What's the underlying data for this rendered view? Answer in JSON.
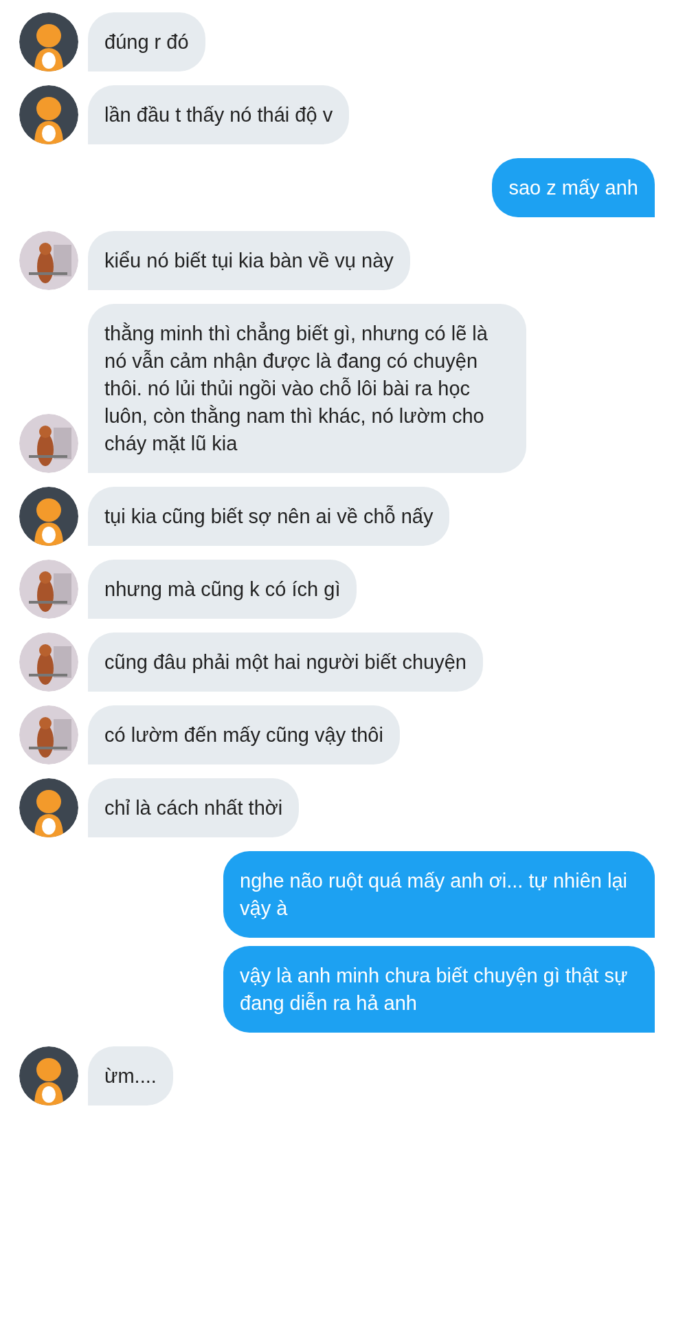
{
  "messages": [
    {
      "kind": "received",
      "color": "#3d4650",
      "text": "đúng r đó"
    },
    {
      "kind": "received",
      "color": "#3d4650",
      "text": "lần đầu t thấy nó thái độ v"
    },
    {
      "kind": "sent",
      "text": "sao z mấy anh"
    },
    {
      "kind": "received",
      "color": "#d9d0d8",
      "text": "kiểu nó biết tụi kia bàn về vụ này"
    },
    {
      "kind": "received",
      "color": "#d9d0d8",
      "text": "thằng minh thì chẳng biết gì, nhưng có lẽ là nó vẫn cảm nhận được là đang có chuyện thôi. nó lủi thủi ngồi vào chỗ lôi bài ra học luôn, còn thằng nam thì khác, nó lườm cho cháy mặt lũ kia"
    },
    {
      "kind": "received",
      "color": "#3d4650",
      "text": "tụi kia cũng biết sợ nên ai về chỗ nấy"
    },
    {
      "kind": "received",
      "color": "#d9d0d8",
      "text": "nhưng mà cũng k có ích gì"
    },
    {
      "kind": "received",
      "color": "#d9d0d8",
      "text": "cũng đâu phải một hai người biết chuyện"
    },
    {
      "kind": "received",
      "color": "#d9d0d8",
      "text": "có lườm đến mấy cũng vậy thôi"
    },
    {
      "kind": "received",
      "color": "#3d4650",
      "text": "chỉ là cách nhất thời"
    },
    {
      "kind": "sent",
      "text": "nghe não ruột quá mấy anh ơi... tự nhiên lại vậy à"
    },
    {
      "kind": "sent",
      "text": "vậy là anh minh chưa biết chuyện gì thật sự đang diễn ra hả anh"
    },
    {
      "kind": "received",
      "color": "#3d4650",
      "text": "ừm...."
    }
  ]
}
